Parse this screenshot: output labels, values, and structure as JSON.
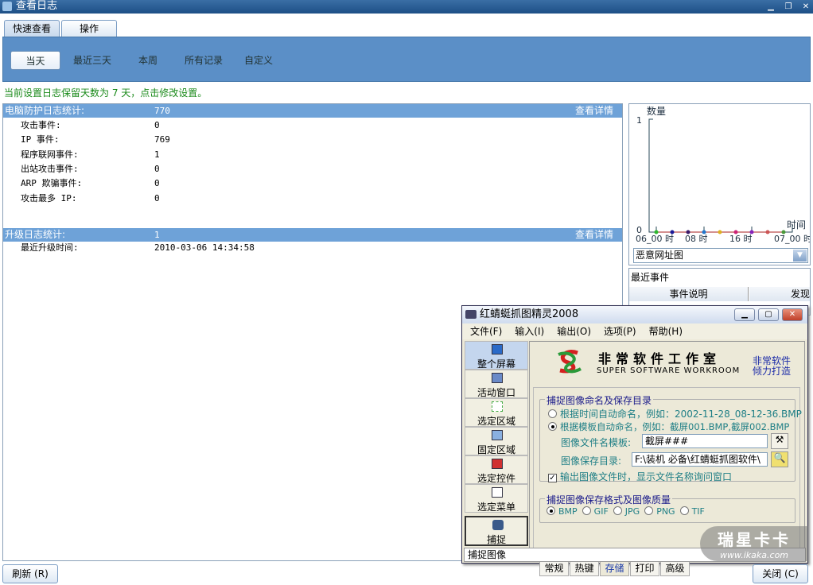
{
  "window": {
    "title": "查看日志"
  },
  "tabs": [
    {
      "label": "快速查看"
    },
    {
      "label": "操作"
    }
  ],
  "quick_filters": [
    {
      "label": "当天"
    },
    {
      "label": "最近三天"
    },
    {
      "label": "本周"
    },
    {
      "label": "所有记录"
    },
    {
      "label": "自定义"
    }
  ],
  "notice": "当前设置日志保留天数为 7 天，点击修改设置。",
  "protection": {
    "title": "电脑防护日志统计:",
    "total": "770",
    "details_link": "查看详情",
    "rows": [
      {
        "label": "攻击事件:",
        "value": "0"
      },
      {
        "label": "IP 事件:",
        "value": "769"
      },
      {
        "label": "程序联网事件:",
        "value": "1"
      },
      {
        "label": "出站攻击事件:",
        "value": "0"
      },
      {
        "label": "ARP 欺骗事件:",
        "value": "0"
      },
      {
        "label": "攻击最多 IP:",
        "value": "0"
      }
    ]
  },
  "upgrade": {
    "title": "升级日志统计:",
    "total": "1",
    "details_link": "查看详情",
    "rows": [
      {
        "label": "最近升级时间:",
        "value": "2010-03-06 14:34:58"
      }
    ]
  },
  "chart_data": {
    "type": "line",
    "ylabel": "数量",
    "xlabel": "时间",
    "ylim": [
      0,
      1
    ],
    "y_ticks": [
      "1",
      "0"
    ],
    "x_ticks": [
      "06_00 时",
      "08 时",
      "16 时",
      "07_00 时"
    ],
    "points": [
      0,
      0,
      0,
      0,
      0,
      0,
      0,
      0,
      0
    ],
    "point_colors": [
      "#2eb82e",
      "#1a1a99",
      "#3a1a6a",
      "#2277cc",
      "#e0b020",
      "#cc2277",
      "#8822bb",
      "#cc5555",
      "#4a9a3a"
    ],
    "line_color": "#aa2222"
  },
  "chart_select": {
    "value": "恶意网址图"
  },
  "events": {
    "title": "最近事件",
    "columns": [
      "事件说明",
      "发现"
    ]
  },
  "buttons": {
    "refresh": "刷新 (R)",
    "close": "关闭 (C)"
  },
  "dialog": {
    "title": "红蜻蜓抓图精灵2008",
    "menu": [
      "文件(F)",
      "输入(I)",
      "输出(O)",
      "选项(P)",
      "帮助(H)"
    ],
    "side": [
      {
        "label": "整个屏幕"
      },
      {
        "label": "活动窗口"
      },
      {
        "label": "选定区域"
      },
      {
        "label": "固定区域"
      },
      {
        "label": "选定控件"
      },
      {
        "label": "选定菜单"
      }
    ],
    "capture": "捕捉",
    "brand_cn": "非常软件工作室",
    "brand_en": "SUPER SOFTWARE WORKROOM",
    "brand_slogan1": "非常软件",
    "brand_slogan2": "倾力打造",
    "group1": {
      "title": "捕捉图像命名及保存目录",
      "opt1": "根据时间自动命名，例如：2002-11-28_08-12-36.BMP",
      "opt2": "根据模板自动命名，例如：截屏001.BMP,截屏002.BMP",
      "template_label": "图像文件名模板:",
      "template_value": "截屏###",
      "dir_label": "图像保存目录:",
      "dir_value": "F:\\装机 必备\\红蜻蜓抓图软件\\",
      "check_label": "输出图像文件时，显示文件名称询问窗口"
    },
    "group2": {
      "title": "捕捉图像保存格式及图像质量",
      "formats": [
        "BMP",
        "GIF",
        "JPG",
        "PNG",
        "TIF"
      ]
    },
    "bottom_tabs": [
      "常规",
      "热键",
      "存储",
      "打印",
      "高级"
    ],
    "status": "捕捉图像"
  },
  "watermark": {
    "line1": "瑞星卡卡",
    "line2": "www.ikaka.com"
  }
}
